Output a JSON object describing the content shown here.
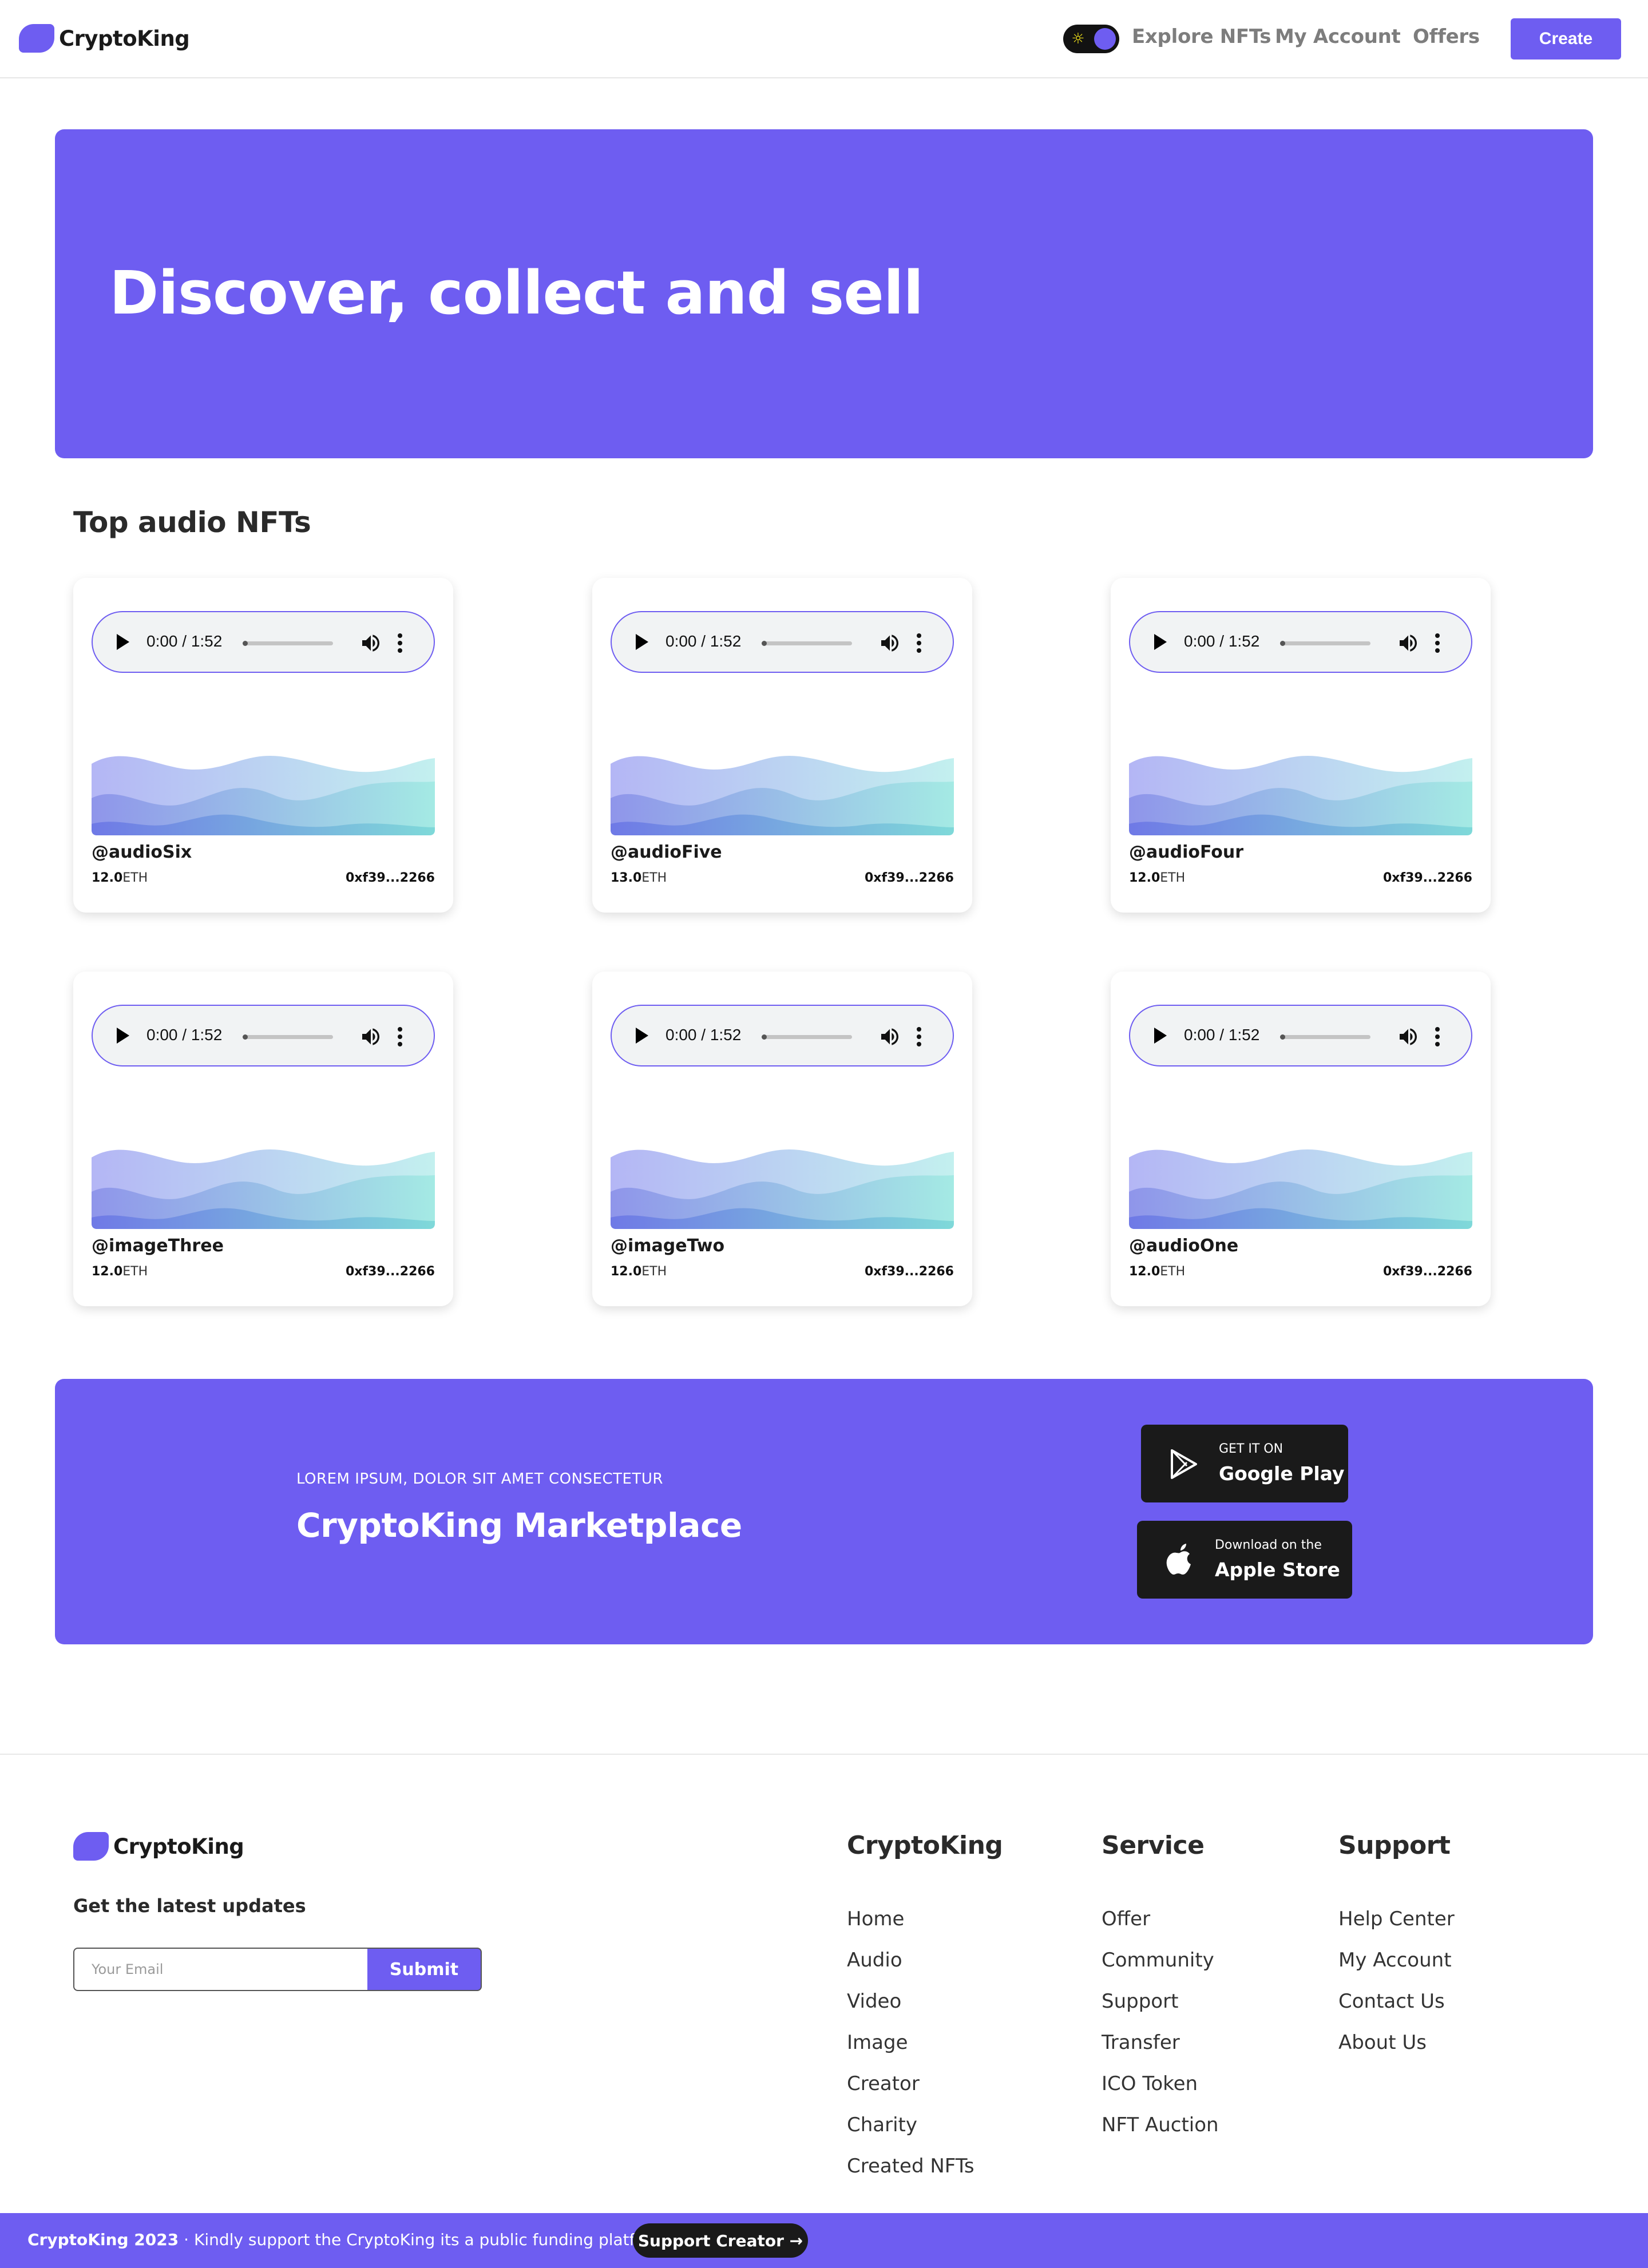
{
  "brand": {
    "name": "CryptoKing",
    "accent": "#6e5df1",
    "dark": "#1a1a1a"
  },
  "nav": {
    "links": [
      "Explore NFTs",
      "My Account",
      "Offers"
    ],
    "create_label": "Create",
    "theme_toggle_icon": "sun-icon"
  },
  "hero": {
    "title": "Discover, collect and sell"
  },
  "section": {
    "title": "Top audio NFTs"
  },
  "cards": [
    {
      "name": "@audioSix",
      "price": "12.0",
      "unit": "ETH",
      "address": "0xf39...2266",
      "time": "0:00 / 1:52"
    },
    {
      "name": "@audioFive",
      "price": "13.0",
      "unit": "ETH",
      "address": "0xf39...2266",
      "time": "0:00 / 1:52"
    },
    {
      "name": "@audioFour",
      "price": "12.0",
      "unit": "ETH",
      "address": "0xf39...2266",
      "time": "0:00 / 1:52"
    },
    {
      "name": "@imageThree",
      "price": "12.0",
      "unit": "ETH",
      "address": "0xf39...2266",
      "time": "0:00 / 1:52"
    },
    {
      "name": "@imageTwo",
      "price": "12.0",
      "unit": "ETH",
      "address": "0xf39...2266",
      "time": "0:00 / 1:52"
    },
    {
      "name": "@audioOne",
      "price": "12.0",
      "unit": "ETH",
      "address": "0xf39...2266",
      "time": "0:00 / 1:52"
    }
  ],
  "banner": {
    "eyebrow": "LOREM IPSUM, DOLOR SIT AMET CONSECTETUR",
    "title": "CryptoKing Marketplace",
    "google": {
      "small": "GET IT ON",
      "big": "Google Play"
    },
    "apple": {
      "small": "Download on the",
      "big": "Apple Store"
    }
  },
  "footer": {
    "brand": "CryptoKing",
    "tagline": "Get the latest updates",
    "email_placeholder": "Your Email",
    "submit_label": "Submit",
    "columns": [
      {
        "title": "CryptoKing",
        "links": [
          "Home",
          "Audio",
          "Video",
          "Image",
          "Creator",
          "Charity",
          "Created NFTs"
        ]
      },
      {
        "title": "Service",
        "links": [
          "Offer",
          "Community",
          "Support",
          "Transfer",
          "ICO Token",
          "NFT Auction"
        ]
      },
      {
        "title": "Support",
        "links": [
          "Help Center",
          "My Account",
          "Contact Us",
          "About Us"
        ]
      }
    ]
  },
  "bottom_bar": {
    "brand_year": "CryptoKing 2023",
    "separator": "·",
    "message": "Kindly support the CryptoKing its a public funding platform",
    "button_label": "Support Creator →"
  }
}
